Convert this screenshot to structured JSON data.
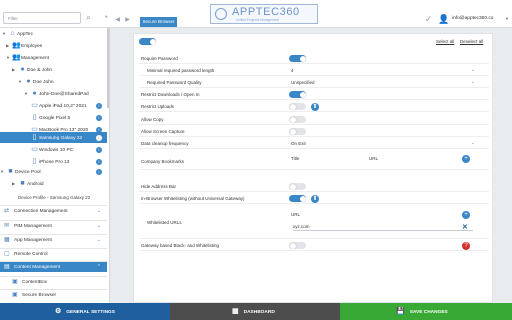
{
  "header": {
    "search_placeholder": "Filter",
    "logo_text": "APPTEC360",
    "logo_subtitle": "Unified Endpoint Management",
    "user_email": "info@apptec360.co"
  },
  "tree": [
    {
      "label": "AppTec",
      "icon": "building-icon"
    },
    {
      "label": "Employee",
      "icon": "users-icon"
    },
    {
      "label": "Management",
      "icon": "users-icon"
    },
    {
      "label": "Doe & John",
      "icon": "user-icon"
    },
    {
      "label": "Doe John",
      "icon": "user-icon"
    },
    {
      "label": "John-Doe@SharedPad",
      "icon": "user-icon"
    },
    {
      "label": "Apple iPad 10,2\" 2021",
      "icon": "tablet-icon"
    },
    {
      "label": "Google Pixel 5",
      "icon": "phone-icon"
    },
    {
      "label": "MacBook Pro 13\" 2020",
      "icon": "laptop-icon"
    },
    {
      "label": "Samsung Galaxy 22",
      "icon": "phone-icon"
    },
    {
      "label": "Windows 10 PC",
      "icon": "monitor-icon"
    },
    {
      "label": "iPhone Pro 13",
      "icon": "phone-icon"
    },
    {
      "label": "Device Pool",
      "icon": "folder-icon"
    },
    {
      "label": "Android",
      "icon": "android-icon"
    }
  ],
  "device_profile": "Device Profile - Samsung Galaxy 22",
  "sections": [
    {
      "label": "Connection Management"
    },
    {
      "label": "PIM Management"
    },
    {
      "label": "App Management"
    },
    {
      "label": "Remote Control"
    },
    {
      "label": "Content Management"
    },
    {
      "label": "ContentBox"
    },
    {
      "label": "Secure Browser"
    }
  ],
  "main_tab": "Secure Browser",
  "select_all": "Select all",
  "deselect_all": "Deselect all",
  "settings": [
    {
      "label": "Require Password",
      "on": true
    },
    {
      "label": "Minimal required password length",
      "value": "4"
    },
    {
      "label": "Required Password Quality",
      "value": "Unspecified"
    },
    {
      "label": "Restrict Downloads / Open In",
      "on": true
    },
    {
      "label": "Restrict Uploads",
      "on": false
    },
    {
      "label": "Allow Copy",
      "on": false
    },
    {
      "label": "Allow Screen Capture",
      "on": false
    },
    {
      "label": "Data cleanup frequency",
      "value": "On Exit"
    },
    {
      "label": "Company Bookmarks",
      "col1": "Title",
      "col2": "URL"
    },
    {
      "label": "Hide Address Bar",
      "on": false
    },
    {
      "label": "In-Browser Whitelisting (without Universal Gateway)",
      "on": true
    },
    {
      "label": "Whitelisted URLs",
      "col1": "URL",
      "url_value": "xyz.com"
    },
    {
      "label": "Gateway based Black- and Whitelisting",
      "on": false
    }
  ],
  "bottom": {
    "general_settings": "GENERAL SETTINGS",
    "dashboard": "DASHBOARD",
    "save_changes": "SAVE CHANGES"
  },
  "colors": {
    "accent": "#3a87c8",
    "bottom_blue": "#1f5f9e",
    "bottom_dark": "#4d4d4d",
    "save_green": "#39a935",
    "help_red": "#d32f2f"
  }
}
